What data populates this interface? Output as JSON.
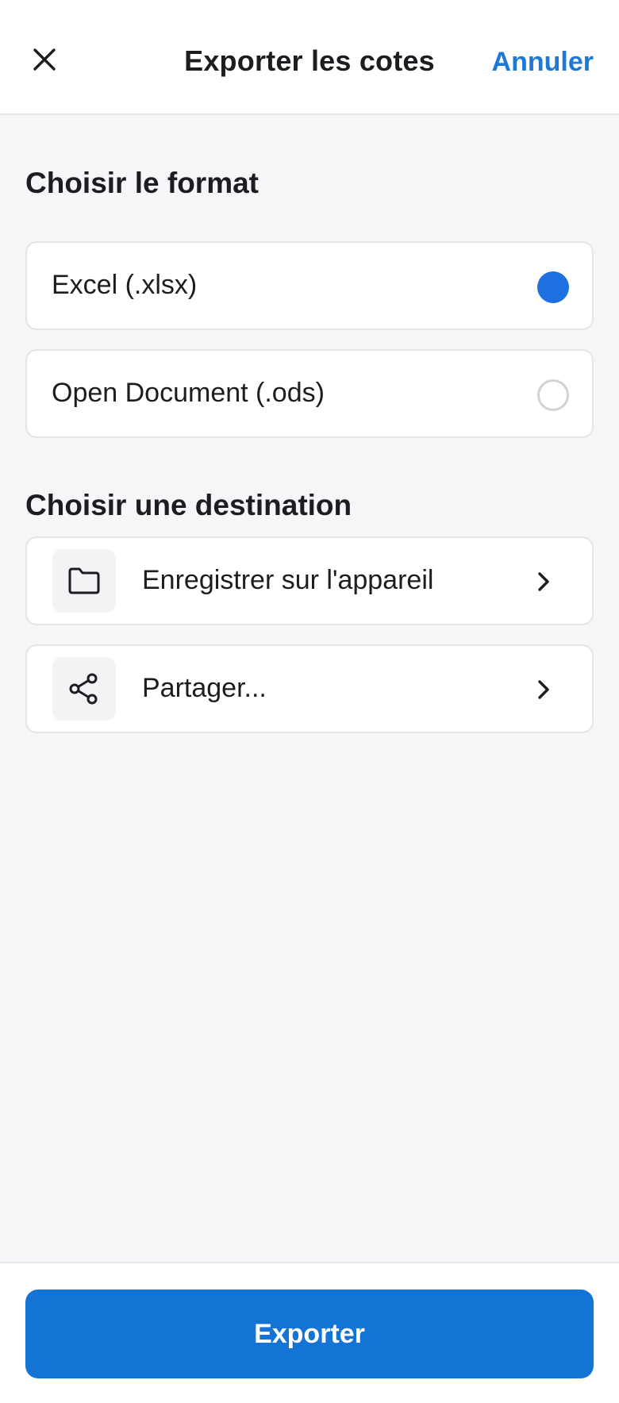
{
  "header": {
    "title": "Exporter les cotes",
    "cancel_label": "Annuler"
  },
  "format_section": {
    "title": "Choisir le format",
    "options": [
      {
        "label": "Excel (.xlsx)",
        "selected": true
      },
      {
        "label": "Open Document (.ods)",
        "selected": false
      }
    ]
  },
  "destination_section": {
    "title": "Choisir une destination",
    "items": [
      {
        "label": "Enregistrer sur l'appareil",
        "icon": "folder-icon"
      },
      {
        "label": "Partager...",
        "icon": "share-icon"
      }
    ]
  },
  "footer": {
    "export_label": "Exporter"
  },
  "colors": {
    "accent": "#1474d6",
    "radio_selected": "#1e6fe0",
    "cancel_text": "#1e78d6"
  }
}
